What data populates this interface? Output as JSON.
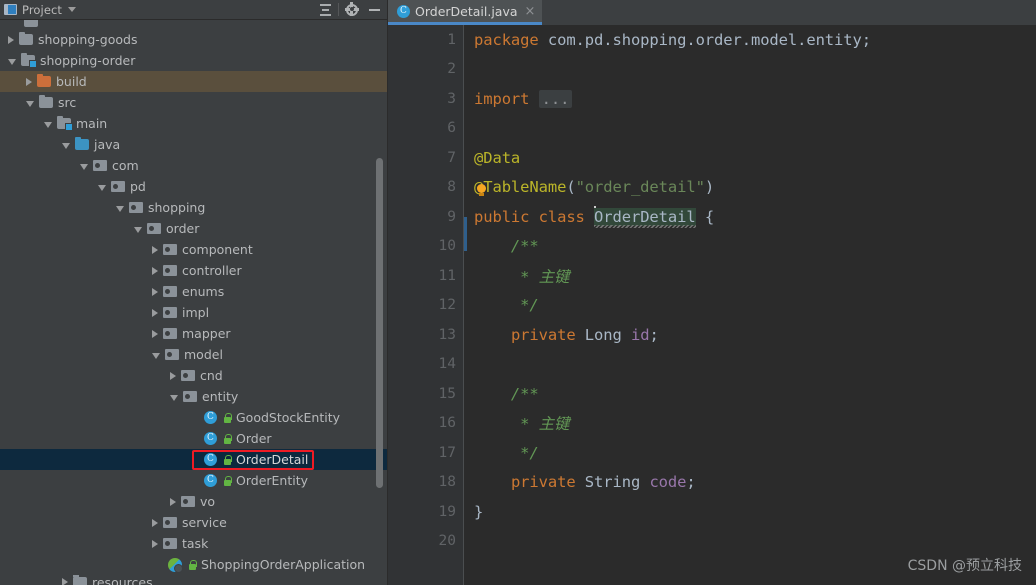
{
  "window": {
    "theme_bg": "#3c3f41",
    "editor_bg": "#2b2b2b",
    "accent": "#4a88c7",
    "annotation_color": "#ee1b24"
  },
  "project_panel": {
    "title": "Project",
    "icons": {
      "project": "project-icon",
      "dropdown": "chevron-down-icon",
      "collapse_all": "collapse-all-icon",
      "settings": "gear-icon",
      "hide": "minimize-icon"
    },
    "tree": [
      {
        "label": "",
        "indent": 0,
        "arrow": "none",
        "icon": "folder",
        "state": "normal",
        "cut": "top"
      },
      {
        "label": "shopping-goods",
        "indent": 0,
        "arrow": "closed",
        "icon": "folder",
        "state": "normal"
      },
      {
        "label": "shopping-order",
        "indent": 0,
        "arrow": "open",
        "icon": "module",
        "state": "normal"
      },
      {
        "label": "build",
        "indent": 1,
        "arrow": "closed",
        "icon": "excluded",
        "state": "hover"
      },
      {
        "label": "src",
        "indent": 1,
        "arrow": "open",
        "icon": "folder",
        "state": "normal"
      },
      {
        "label": "main",
        "indent": 2,
        "arrow": "open",
        "icon": "module",
        "state": "normal"
      },
      {
        "label": "java",
        "indent": 3,
        "arrow": "open",
        "icon": "srcroot",
        "state": "normal"
      },
      {
        "label": "com",
        "indent": 4,
        "arrow": "open",
        "icon": "package",
        "state": "normal"
      },
      {
        "label": "pd",
        "indent": 5,
        "arrow": "open",
        "icon": "package",
        "state": "normal"
      },
      {
        "label": "shopping",
        "indent": 6,
        "arrow": "open",
        "icon": "package",
        "state": "normal"
      },
      {
        "label": "order",
        "indent": 7,
        "arrow": "open",
        "icon": "package",
        "state": "normal"
      },
      {
        "label": "component",
        "indent": 8,
        "arrow": "closed",
        "icon": "package",
        "state": "normal"
      },
      {
        "label": "controller",
        "indent": 8,
        "arrow": "closed",
        "icon": "package",
        "state": "normal"
      },
      {
        "label": "enums",
        "indent": 8,
        "arrow": "closed",
        "icon": "package",
        "state": "normal"
      },
      {
        "label": "impl",
        "indent": 8,
        "arrow": "closed",
        "icon": "package",
        "state": "normal"
      },
      {
        "label": "mapper",
        "indent": 8,
        "arrow": "closed",
        "icon": "package",
        "state": "normal"
      },
      {
        "label": "model",
        "indent": 8,
        "arrow": "open",
        "icon": "package",
        "state": "normal"
      },
      {
        "label": "cnd",
        "indent": 9,
        "arrow": "closed",
        "icon": "package",
        "state": "normal"
      },
      {
        "label": "entity",
        "indent": 9,
        "arrow": "open",
        "icon": "package",
        "state": "normal"
      },
      {
        "label": "GoodStockEntity",
        "indent": 10,
        "arrow": "none",
        "icon": "class",
        "state": "normal",
        "badge": "lock"
      },
      {
        "label": "Order",
        "indent": 10,
        "arrow": "none",
        "icon": "class",
        "state": "normal",
        "badge": "lock"
      },
      {
        "label": "OrderDetail",
        "indent": 10,
        "arrow": "none",
        "icon": "class",
        "state": "selected",
        "badge": "lock",
        "annotated": true
      },
      {
        "label": "OrderEntity",
        "indent": 10,
        "arrow": "none",
        "icon": "class",
        "state": "normal",
        "badge": "lock"
      },
      {
        "label": "vo",
        "indent": 9,
        "arrow": "closed",
        "icon": "package",
        "state": "normal"
      },
      {
        "label": "service",
        "indent": 8,
        "arrow": "closed",
        "icon": "package",
        "state": "normal"
      },
      {
        "label": "task",
        "indent": 8,
        "arrow": "closed",
        "icon": "package",
        "state": "normal"
      },
      {
        "label": "ShoppingOrderApplication",
        "indent": 8,
        "arrow": "none",
        "icon": "spring",
        "state": "normal",
        "badge": "lock"
      },
      {
        "label": "resources",
        "indent": 3,
        "arrow": "closed",
        "icon": "folder",
        "state": "normal",
        "cut": "bottom"
      }
    ]
  },
  "editor": {
    "tabs": [
      {
        "label": "OrderDetail.java",
        "icon": "java-class-icon",
        "active": true,
        "close": "×"
      }
    ],
    "lines": [
      {
        "num": "1",
        "fold": "none",
        "tokens": [
          {
            "t": "kw",
            "v": "package"
          },
          {
            "t": "txt",
            "v": " com.pd.shopping.order.model.entity;"
          }
        ]
      },
      {
        "num": "2",
        "fold": "none",
        "tokens": []
      },
      {
        "num": "3",
        "fold": "plus",
        "tokens": [
          {
            "t": "kw",
            "v": "import"
          },
          {
            "t": "txt",
            "v": " "
          },
          {
            "t": "foldph",
            "v": "..."
          }
        ]
      },
      {
        "num": "6",
        "fold": "none",
        "tokens": []
      },
      {
        "num": "7",
        "fold": "tri-down",
        "tokens": [
          {
            "t": "ann",
            "v": "@Data"
          }
        ]
      },
      {
        "num": "8",
        "fold": "tri-up",
        "tokens": [
          {
            "t": "bulb",
            "v": ""
          },
          {
            "t": "ann",
            "v": "@TableName"
          },
          {
            "t": "punc",
            "v": "("
          },
          {
            "t": "str",
            "v": "\"order_detail\""
          },
          {
            "t": "punc",
            "v": ")"
          }
        ]
      },
      {
        "num": "9",
        "fold": "none",
        "tokens": [
          {
            "t": "kw",
            "v": "public class"
          },
          {
            "t": "txt",
            "v": " "
          },
          {
            "t": "caret",
            "v": ""
          },
          {
            "t": "hl",
            "v": "OrderDetail"
          },
          {
            "t": "txt",
            "v": " {"
          }
        ]
      },
      {
        "num": "10",
        "fold": "tri-down",
        "tokens": [
          {
            "t": "cmt",
            "v": "    /**"
          }
        ]
      },
      {
        "num": "11",
        "fold": "none",
        "tokens": [
          {
            "t": "cmt",
            "v": "     * 主键"
          }
        ]
      },
      {
        "num": "12",
        "fold": "simple",
        "tokens": [
          {
            "t": "cmt",
            "v": "     */"
          }
        ]
      },
      {
        "num": "13",
        "fold": "none",
        "tokens": [
          {
            "t": "txt",
            "v": "    "
          },
          {
            "t": "kw",
            "v": "private"
          },
          {
            "t": "txt",
            "v": " "
          },
          {
            "t": "cls",
            "v": "Long"
          },
          {
            "t": "txt",
            "v": " "
          },
          {
            "t": "fld",
            "v": "id"
          },
          {
            "t": "punc",
            "v": ";"
          }
        ]
      },
      {
        "num": "14",
        "fold": "none",
        "tokens": []
      },
      {
        "num": "15",
        "fold": "tri-down",
        "tokens": [
          {
            "t": "cmt",
            "v": "    /**"
          }
        ]
      },
      {
        "num": "16",
        "fold": "none",
        "tokens": [
          {
            "t": "cmt",
            "v": "     * 主键"
          }
        ]
      },
      {
        "num": "17",
        "fold": "simple",
        "tokens": [
          {
            "t": "cmt",
            "v": "     */"
          }
        ]
      },
      {
        "num": "18",
        "fold": "none",
        "tokens": [
          {
            "t": "txt",
            "v": "    "
          },
          {
            "t": "kw",
            "v": "private"
          },
          {
            "t": "txt",
            "v": " "
          },
          {
            "t": "cls",
            "v": "String"
          },
          {
            "t": "txt",
            "v": " "
          },
          {
            "t": "fld",
            "v": "code"
          },
          {
            "t": "punc",
            "v": ";"
          }
        ]
      },
      {
        "num": "19",
        "fold": "none",
        "tokens": [
          {
            "t": "txt",
            "v": "}"
          }
        ]
      },
      {
        "num": "20",
        "fold": "none",
        "tokens": []
      }
    ]
  },
  "watermark": {
    "text": "CSDN @预立科技"
  }
}
